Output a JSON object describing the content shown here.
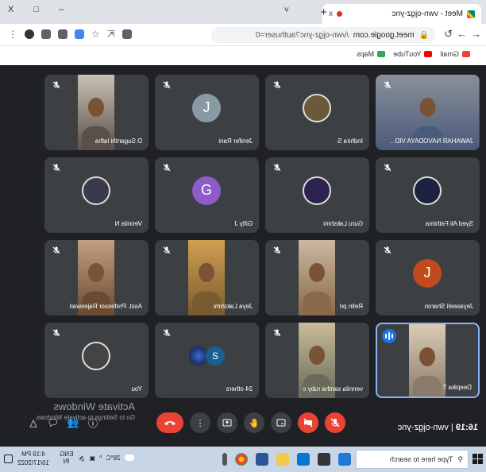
{
  "browser": {
    "tab_title": "Meet - vwn-ojgz-ync",
    "new_tab_symbol": "+",
    "close_symbol": "x",
    "window_controls": [
      "–",
      "□",
      "X"
    ],
    "tab_menu_symbol": "˅",
    "url_host": "meet.google.com",
    "url_path": "/vwn-ojgz-ync?authuser=0",
    "bookmarks": [
      {
        "label": "Gmail",
        "icon": "gmail-icon",
        "color": "#ea4335"
      },
      {
        "label": "YouTube",
        "icon": "youtube-icon",
        "color": "#ff0000"
      },
      {
        "label": "Maps",
        "icon": "maps-icon",
        "color": "#34a853"
      }
    ]
  },
  "meet": {
    "participants": [
      {
        "name": "JAWAHAR NAVODAYA VID...",
        "type": "video",
        "video_colors": [
          "#4a5a7a",
          "#8a8f9a"
        ]
      },
      {
        "name": "Indhira S",
        "type": "photo",
        "avatar_color": "#6b5a3a"
      },
      {
        "name": "Jenifer Rani",
        "type": "initial",
        "initial": "J",
        "avatar_color": "#8a9aa4"
      },
      {
        "name": "D.Suganthi latha",
        "type": "video",
        "video_colors": [
          "#5a5048",
          "#c8c0b4"
        ]
      },
      {
        "name": "Syed Ali Fathima",
        "type": "photo",
        "avatar_color": "#1c2240"
      },
      {
        "name": "Guru Lakshmi",
        "type": "photo",
        "avatar_color": "#2e2250"
      },
      {
        "name": "Gifty J",
        "type": "initial",
        "initial": "G",
        "avatar_color": "#8d5cc9"
      },
      {
        "name": "Vennila N",
        "type": "photo",
        "avatar_color": "#3a3a4a"
      },
      {
        "name": "Jeyaseeli Sharon",
        "type": "initial",
        "initial": "J",
        "avatar_color": "#c04a1e"
      },
      {
        "name": "Relin pri",
        "type": "video",
        "video_colors": [
          "#8a6a4a",
          "#c9b8a0"
        ]
      },
      {
        "name": "Jeya Lakshmi",
        "type": "video",
        "video_colors": [
          "#7a5a30",
          "#d0a050"
        ]
      },
      {
        "name": "Asst. Professor Rajeswari",
        "type": "video",
        "video_colors": [
          "#6a4a30",
          "#c0a080"
        ]
      },
      {
        "name": "Deepika T",
        "type": "video",
        "speaking": true,
        "video_colors": [
          "#8a7a6a",
          "#d9cbb5"
        ]
      },
      {
        "name": "vennila santha ruby c",
        "type": "video",
        "video_colors": [
          "#6a6a5a",
          "#c8bc98"
        ]
      },
      {
        "name": "24 others",
        "type": "others",
        "initial": "S",
        "avatar_color": "#1a5f8f"
      },
      {
        "name": "You",
        "type": "photo",
        "avatar_color": "#444444"
      }
    ],
    "time": "16:19",
    "separator": "|",
    "meeting_code": "vwn-ojgz-ync",
    "controls": [
      {
        "name": "mic-off-button",
        "icon": "mic-off-icon",
        "red": true
      },
      {
        "name": "camera-off-button",
        "icon": "camera-off-icon",
        "red": true
      },
      {
        "name": "captions-button",
        "icon": "captions-icon",
        "red": false
      },
      {
        "name": "raise-hand-button",
        "icon": "hand-icon",
        "red": false
      },
      {
        "name": "present-button",
        "icon": "present-icon",
        "red": false
      },
      {
        "name": "more-options-button",
        "icon": "more-vert-icon",
        "red": false
      },
      {
        "name": "leave-call-button",
        "icon": "phone-hangup-icon",
        "red": true
      }
    ],
    "side_icons": [
      "info-icon",
      "people-icon",
      "chat-icon",
      "activities-icon"
    ]
  },
  "watermark": {
    "title": "Activate Windows",
    "subtitle": "Go to Settings to activate Windows."
  },
  "taskbar": {
    "search_placeholder": "Type here to search",
    "weather": "28°C",
    "tray_symbol": "^",
    "language": "ENG",
    "region": "IN",
    "time": "4:19 PM",
    "date": "10/17/2022"
  }
}
